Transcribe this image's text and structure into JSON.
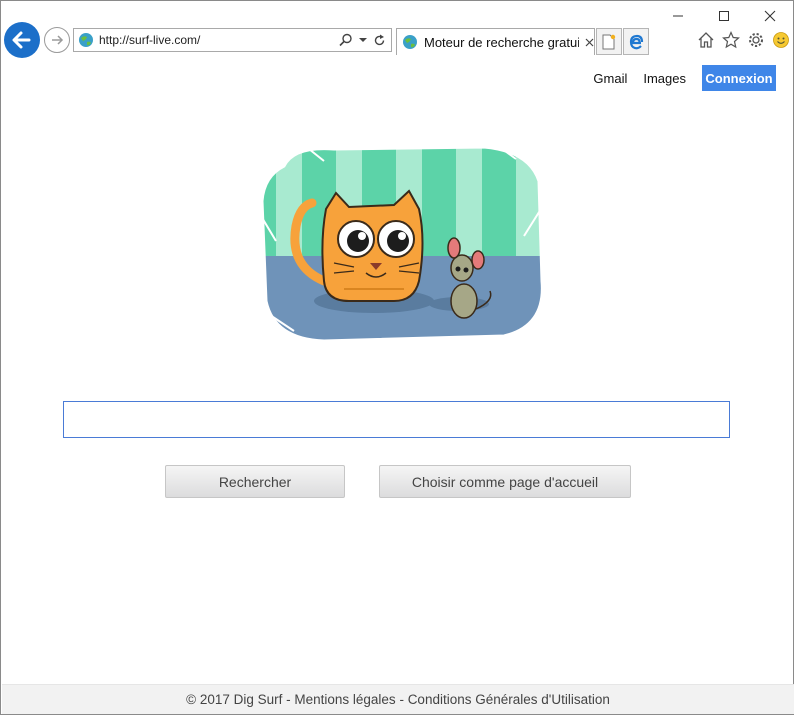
{
  "browser": {
    "address_url": "http://surf-live.com/",
    "tab_title": "Moteur de recherche gratui...",
    "window_controls": [
      "minimize-icon",
      "maximize-icon",
      "close-icon"
    ],
    "toolbar_icons": [
      "home-icon",
      "star-icon",
      "gear-icon",
      "smiley-icon"
    ]
  },
  "topnav": {
    "gmail": "Gmail",
    "images": "Images",
    "login": "Connexion"
  },
  "search": {
    "value": "",
    "placeholder": ""
  },
  "buttons": {
    "search": "Rechercher",
    "homepage": "Choisir comme page d'accueil"
  },
  "footer": {
    "copyright": "© 2017 Dig Surf",
    "sep1": " - ",
    "legal": "Mentions légales",
    "sep2": " - ",
    "terms": "Conditions Générales d'Utilisation"
  },
  "colors": {
    "accent": "#3f86e8",
    "back_button": "#1c6fc9",
    "logo_wall": "#5cd3a8",
    "logo_floor": "#6f93b9",
    "cat_orange": "#f7a23b"
  }
}
